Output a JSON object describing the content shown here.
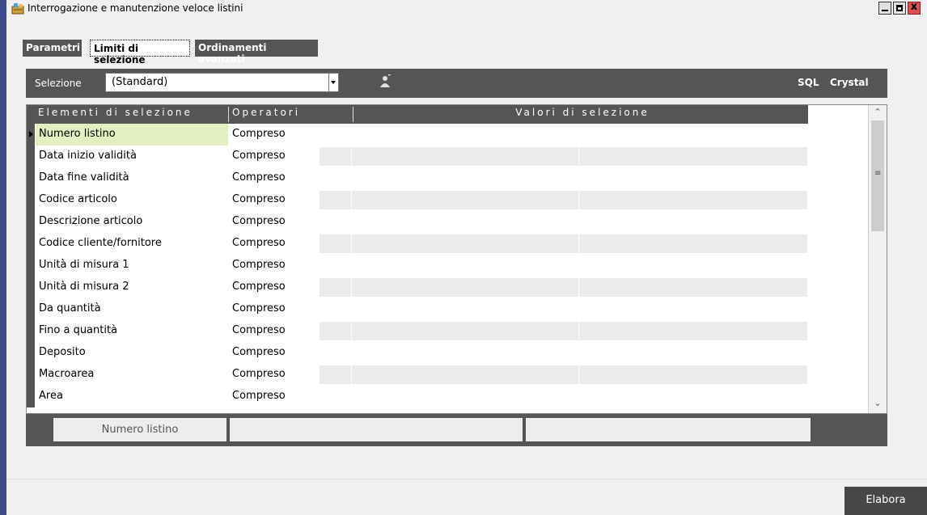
{
  "window": {
    "title": "Interrogazione e manutenzione veloce listini",
    "close_glyph": "x"
  },
  "tabs": [
    {
      "label": "Parametri",
      "active": false
    },
    {
      "label": "Limiti di selezione",
      "active": true
    },
    {
      "label": "Ordinamenti avanzati",
      "active": false
    }
  ],
  "toolbar": {
    "selection_label": "Selezione",
    "selection_value": "(Standard)",
    "sql_label": "SQL",
    "crystal_label": "Crystal"
  },
  "grid": {
    "columns": [
      "Elementi di selezione",
      "Operatori",
      "Valori di selezione"
    ],
    "rows": [
      {
        "element": "Numero listino",
        "operator": "Compreso"
      },
      {
        "element": "Data inizio validità",
        "operator": "Compreso"
      },
      {
        "element": "Data fine validità",
        "operator": "Compreso"
      },
      {
        "element": "Codice articolo",
        "operator": "Compreso"
      },
      {
        "element": "Descrizione articolo",
        "operator": "Compreso"
      },
      {
        "element": "Codice cliente/fornitore",
        "operator": "Compreso"
      },
      {
        "element": "Unità di misura 1",
        "operator": "Compreso"
      },
      {
        "element": "Unità di misura 2",
        "operator": "Compreso"
      },
      {
        "element": "Da quantità",
        "operator": "Compreso"
      },
      {
        "element": "Fino a quantità",
        "operator": "Compreso"
      },
      {
        "element": "Deposito",
        "operator": "Compreso"
      },
      {
        "element": "Macroarea",
        "operator": "Compreso"
      },
      {
        "element": "Area",
        "operator": "Compreso"
      }
    ]
  },
  "footer": {
    "current_element": "Numero listino"
  },
  "actions": {
    "elabora_label": "Elabora"
  },
  "colors": {
    "dark_bar": "#555555",
    "current_row": "#e3efc0"
  }
}
